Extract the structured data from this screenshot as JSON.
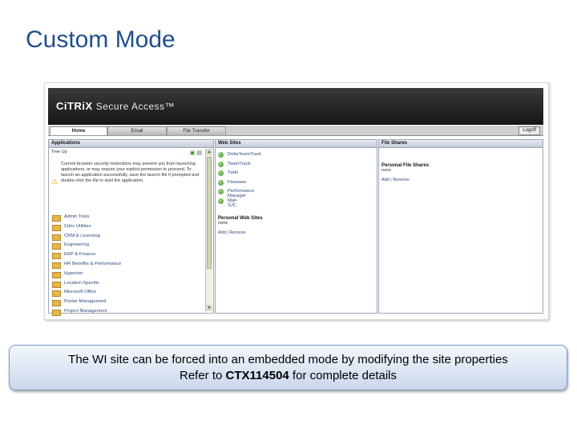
{
  "slide": {
    "title": "Custom Mode"
  },
  "app": {
    "logo_brand": "CiTRiX",
    "logo_product": "Secure Access™",
    "tabs": [
      {
        "label": "Home",
        "active": true
      },
      {
        "label": "Email",
        "active": false
      },
      {
        "label": "File Transfer",
        "active": false
      }
    ],
    "logoff_label": "Logoff"
  },
  "applications": {
    "header": "Applications",
    "toolbar_left": "Tree  Up",
    "warning": "Current browser security restrictions may prevent you from launching applications, or may require your explicit permission to proceed. To launch an application successfully, save the launch file if prompted and double-click the file to start the application.",
    "folders": [
      "Admin Tools",
      "Citrix Utilities",
      "CRM & Licensing",
      "Engineering",
      "ERP & Finance",
      "HR Benefits & Performance",
      "Hyperion",
      "Location Specific",
      "Microsoft Office",
      "Printer Management",
      "Project Management"
    ]
  },
  "web_sites": {
    "header": "Web Sites",
    "sites": [
      "DeltaTeamTrack",
      "TeamTrack",
      "Twiki",
      "Flexware",
      "Performance Manager",
      "Mail-SJC"
    ],
    "personal_title": "Personal Web Sites",
    "personal_value": "none",
    "add_label": "Add",
    "remove_label": "Remove"
  },
  "file_shares": {
    "header": "File Shares",
    "personal_title": "Personal File Shares",
    "personal_value": "none",
    "add_label": "Add",
    "remove_label": "Remove"
  },
  "callout": {
    "line1": "The WI site can be forced into an embedded mode by modifying the site properties",
    "line2_prefix": "Refer to ",
    "line2_ref": "CTX114504",
    "line2_suffix": " for complete details"
  },
  "colors": {
    "title": "#1f4e8c",
    "header_bg": "#1e1e1e",
    "callout_border": "#7f9cc4"
  }
}
